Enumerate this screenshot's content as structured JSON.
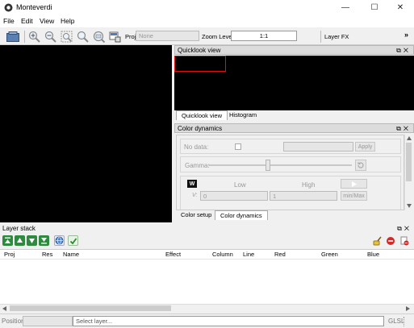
{
  "window": {
    "title": "Monteverdi",
    "controls": {
      "minimize": "—",
      "maximize": "☐",
      "close": "✕"
    }
  },
  "menubar": {
    "items": [
      "File",
      "Edit",
      "View",
      "Help"
    ]
  },
  "toolbar": {
    "proj_label": "Proj",
    "proj_value": "None",
    "zoom_label": "Zoom Level",
    "zoom_value": "1:1",
    "layer_fx_label": "Layer FX",
    "overflow": "»"
  },
  "quicklook": {
    "title": "Quicklook view",
    "tabs": [
      "Quicklook view",
      "Histogram"
    ],
    "active_tab": 0
  },
  "color_dynamics": {
    "title": "Color dynamics",
    "no_data_label": "No data:",
    "apply_label": "Apply",
    "gamma_label": "Gamma:",
    "gamma_value": 0.41,
    "channel_button": "W",
    "low_label": "Low",
    "high_label": "High",
    "v_label": "V:",
    "low_value": "0",
    "high_value": "1",
    "minmax_label": "min/Max",
    "tabs": [
      "Color setup",
      "Color dynamics"
    ],
    "active_tab": 1
  },
  "layer_stack": {
    "title": "Layer stack",
    "columns": [
      "Proj",
      "Res",
      "Name",
      "Effect",
      "Column",
      "Line",
      "Red",
      "Green",
      "Blue"
    ],
    "rows": []
  },
  "statusbar": {
    "position_label": "Position",
    "select_layer_placeholder": "Select layer...",
    "glsl_label": "GLSL"
  }
}
